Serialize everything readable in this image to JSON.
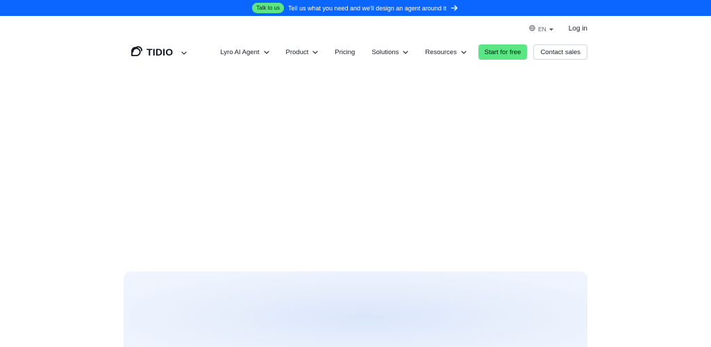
{
  "announcement": {
    "badge": "Talk to us",
    "text": "Tell us what you need and we'll design an agent around it"
  },
  "utility": {
    "language": "EN",
    "login": "Log in"
  },
  "brand": {
    "name": "TIDIO"
  },
  "nav": {
    "items": [
      {
        "label": "Lyro AI Agent",
        "has_dropdown": true
      },
      {
        "label": "Product",
        "has_dropdown": true
      },
      {
        "label": "Pricing",
        "has_dropdown": false
      },
      {
        "label": "Solutions",
        "has_dropdown": true
      },
      {
        "label": "Resources",
        "has_dropdown": true
      }
    ],
    "start_label": "Start for free",
    "contact_label": "Contact sales"
  },
  "colors": {
    "announcement_bg": "#0a66ff",
    "accent_green": "#5be584"
  }
}
